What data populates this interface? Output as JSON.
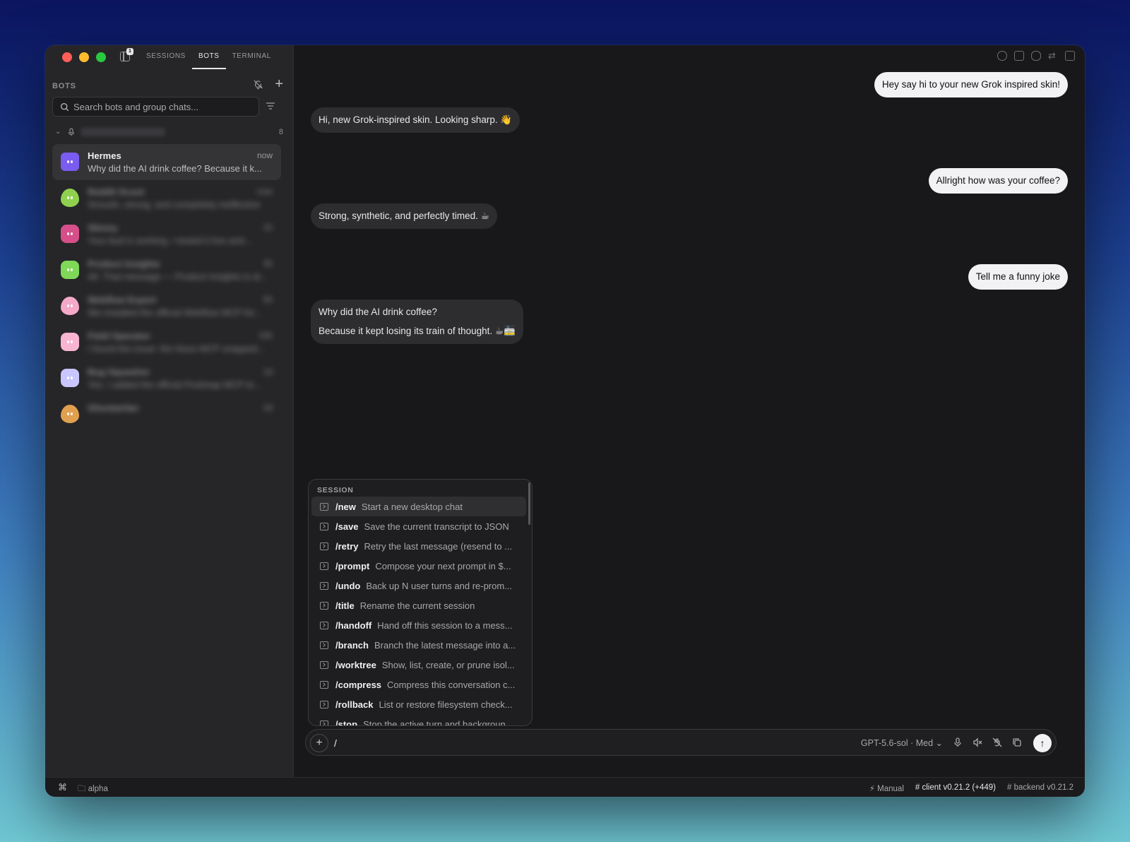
{
  "titlebar": {
    "sidebar_badge": "1",
    "tabs": [
      "SESSIONS",
      "BOTS",
      "TERMINAL"
    ]
  },
  "sidebar": {
    "title": "BOTS",
    "search_placeholder": "Search bots and group chats...",
    "group_count": "8",
    "bots": [
      {
        "name": "Hermes",
        "time": "now",
        "preview": "Why did the AI drink coffee? Because it k...",
        "color": "#7b5cf0",
        "active": true,
        "blurred": false
      },
      {
        "name": "Reddit Scout",
        "time": "now",
        "preview": "Smooth, strong, and completely ineffective",
        "color": "#8fd14f",
        "active": false,
        "blurred": true
      },
      {
        "name": "Skinny",
        "time": "1h",
        "preview": "Your bud is working. I tested it live and...",
        "color": "#d64f8a",
        "active": false,
        "blurred": true
      },
      {
        "name": "Product Insights",
        "time": "3h",
        "preview": "All. That message — Product Insights is al...",
        "color": "#7fd857",
        "active": false,
        "blurred": true
      },
      {
        "name": "Webflow Expert",
        "time": "5h",
        "preview": "We installed the official Webflow MCP for...",
        "color": "#f4a9c8",
        "active": false,
        "blurred": true
      },
      {
        "name": "Field Operator",
        "time": "10h",
        "preview": "I found the issue: the Nous MCP snapped...",
        "color": "#f7b5d2",
        "active": false,
        "blurred": true
      },
      {
        "name": "Bug Squasher",
        "time": "1d",
        "preview": "Yes. I added the official Postmap MCP to...",
        "color": "#c9c6ff",
        "active": false,
        "blurred": true
      },
      {
        "name": "Ghostwriter",
        "time": "2d",
        "preview": "",
        "color": "#e0a050",
        "active": false,
        "blurred": true
      }
    ]
  },
  "chat": {
    "messages": [
      {
        "role": "user",
        "lines": [
          "Hey say hi to your new Grok inspired skin!"
        ]
      },
      {
        "role": "bot",
        "lines": [
          "Hi, new Grok-inspired skin. Looking sharp. 👋"
        ]
      },
      {
        "role": "user",
        "lines": [
          "Allright how was your coffee?"
        ]
      },
      {
        "role": "bot",
        "lines": [
          "Strong, synthetic, and perfectly timed. ☕"
        ]
      },
      {
        "role": "user",
        "lines": [
          "Tell me a funny joke"
        ]
      },
      {
        "role": "bot",
        "lines": [
          "Why did the AI drink coffee?",
          "Because it kept losing its train of thought. ☕🚋"
        ]
      }
    ]
  },
  "palette": {
    "title": "SESSION",
    "commands": [
      {
        "name": "/new",
        "desc": "Start a new desktop chat"
      },
      {
        "name": "/save",
        "desc": "Save the current transcript to JSON"
      },
      {
        "name": "/retry",
        "desc": "Retry the last message (resend to ..."
      },
      {
        "name": "/prompt",
        "desc": "Compose your next prompt in $..."
      },
      {
        "name": "/undo",
        "desc": "Back up N user turns and re-prom..."
      },
      {
        "name": "/title",
        "desc": "Rename the current session"
      },
      {
        "name": "/handoff",
        "desc": "Hand off this session to a mess..."
      },
      {
        "name": "/branch",
        "desc": "Branch the latest message into a..."
      },
      {
        "name": "/worktree",
        "desc": "Show, list, create, or prune isol..."
      },
      {
        "name": "/compress",
        "desc": "Compress this conversation c..."
      },
      {
        "name": "/rollback",
        "desc": "List or restore filesystem check..."
      },
      {
        "name": "/stop",
        "desc": "Stop the active turn and backgroun..."
      }
    ]
  },
  "composer": {
    "value": "/",
    "model": "GPT-5.6-sol · Med"
  },
  "statusbar": {
    "folder": "alpha",
    "mode": "Manual",
    "client": "client v0.21.2 (+449)",
    "backend": "backend v0.21.2"
  }
}
